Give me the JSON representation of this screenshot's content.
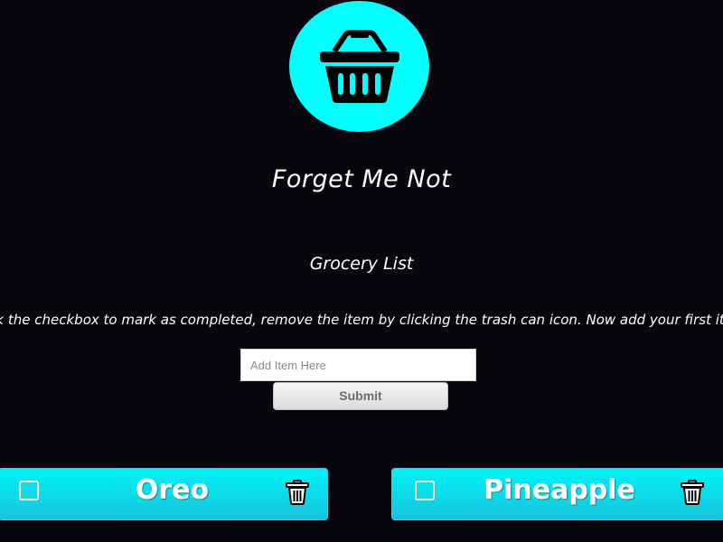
{
  "app": {
    "title": "Forget Me Not",
    "logo_icon": "shopping-basket-icon",
    "logo_color": "#00ffff"
  },
  "list": {
    "title": "Grocery List",
    "instructions": "Click the checkbox to mark as completed, remove the item by clicking the trash can icon. Now add your first item!"
  },
  "form": {
    "input_value": "",
    "input_placeholder": "Add Item Here",
    "submit_label": "Submit"
  },
  "items": [
    {
      "label": "Oreo",
      "checked": false,
      "check_icon": "checkbox-icon",
      "delete_icon": "trash-icon"
    },
    {
      "label": "Pineapple",
      "checked": false,
      "check_icon": "checkbox-icon",
      "delete_icon": "trash-icon"
    }
  ],
  "colors": {
    "background": "#0a060d",
    "accent": "#00ffff",
    "card_gradient_top": "#00f2f6",
    "card_gradient_bottom": "#16c4dc"
  }
}
